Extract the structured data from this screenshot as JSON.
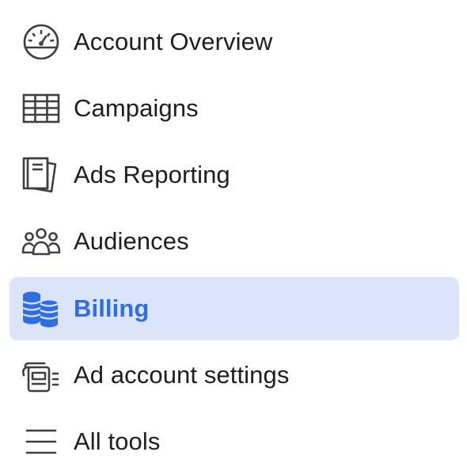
{
  "sidebar": {
    "items": [
      {
        "label": "Account Overview",
        "icon": "gauge-icon",
        "active": false
      },
      {
        "label": "Campaigns",
        "icon": "table-grid-icon",
        "active": false
      },
      {
        "label": "Ads Reporting",
        "icon": "reports-icon",
        "active": false
      },
      {
        "label": "Audiences",
        "icon": "people-group-icon",
        "active": false
      },
      {
        "label": "Billing",
        "icon": "coin-stacks-icon",
        "active": true
      },
      {
        "label": "Ad account settings",
        "icon": "settings-cards-icon",
        "active": false
      },
      {
        "label": "All tools",
        "icon": "hamburger-menu-icon",
        "active": false
      }
    ],
    "colors": {
      "active_background": "#dbe4f9",
      "active_text": "#2f6ee0",
      "text": "#1c1e21",
      "icon": "#3c3f44"
    }
  }
}
